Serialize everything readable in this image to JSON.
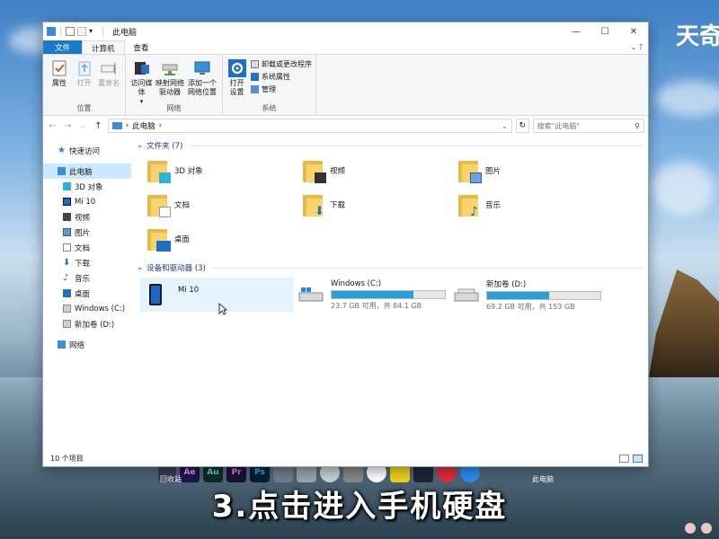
{
  "window": {
    "title": "此电脑",
    "controls": {
      "minimize": "—",
      "maximize": "☐",
      "close": "✕"
    }
  },
  "ribbon": {
    "tabs": [
      {
        "label": "文件"
      },
      {
        "label": "计算机"
      },
      {
        "label": "查看"
      }
    ],
    "groups": {
      "location": {
        "label": "位置",
        "buttons": {
          "properties": "属性",
          "open": "打开",
          "rename": "重命名"
        }
      },
      "network": {
        "label": "网络",
        "buttons": {
          "access_media": "访问媒体",
          "map_drive_1": "映射网络",
          "map_drive_2": "驱动器",
          "add_location_1": "添加一个",
          "add_location_2": "网络位置"
        }
      },
      "system": {
        "label": "系统",
        "buttons": {
          "open_settings_1": "打开",
          "open_settings_2": "设置",
          "uninstall": "卸载或更改程序",
          "system_props": "系统属性",
          "manage": "管理"
        }
      }
    }
  },
  "address": {
    "path": "此电脑",
    "search_placeholder": "搜索\"此电脑\""
  },
  "nav": {
    "quick_access": "快速访问",
    "this_pc": "此电脑",
    "items": [
      "3D 对象",
      "Mi 10",
      "视频",
      "图片",
      "文档",
      "下载",
      "音乐",
      "桌面",
      "Windows (C:)",
      "新加卷 (D:)"
    ],
    "network": "网络"
  },
  "folders_section": {
    "header": "文件夹 (7)",
    "folders": [
      "3D 对象",
      "视频",
      "图片",
      "文档",
      "下载",
      "音乐",
      "桌面"
    ]
  },
  "devices_section": {
    "header": "设备和驱动器 (3)",
    "phone": {
      "name": "Mi 10"
    },
    "drives": [
      {
        "name": "Windows (C:)",
        "usage": "23.7 GB 可用，共 84.1 GB",
        "used_fraction": 0.72
      },
      {
        "name": "新加卷 (D:)",
        "usage": "69.2 GB 可用，共 153 GB",
        "used_fraction": 0.55
      }
    ]
  },
  "status": {
    "count": "10 个项目"
  },
  "desktop": {
    "logo": "天奇",
    "taskbar_labels": {
      "recycle": "回收站",
      "this_pc": "此电脑"
    },
    "taskbar_icons": [
      "Ae",
      "Au",
      "Pr",
      "Ps"
    ],
    "caption": "3.点击进入手机硬盘"
  },
  "colors": {
    "accent": "#1979ca",
    "drive_bar": "#26a0da",
    "selection": "#cce8ff"
  }
}
